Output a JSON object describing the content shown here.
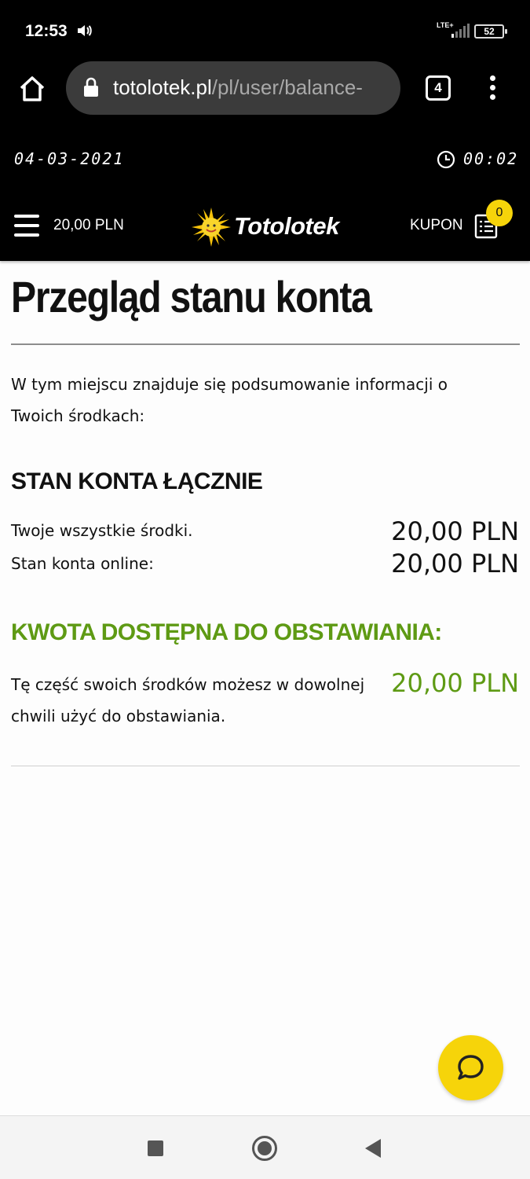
{
  "status_bar": {
    "time": "12:53",
    "network": "LTE+",
    "battery": "52",
    "icons": [
      "volume-icon",
      "signal-icon",
      "battery-icon"
    ]
  },
  "browser": {
    "url_domain": "totolotek.pl",
    "url_path": "/pl/user/balance-",
    "tab_count": "4",
    "icons": [
      "home-icon",
      "lock-icon",
      "more-vert-icon"
    ]
  },
  "site_header": {
    "date": "04-03-2021",
    "timer": "00:02",
    "balance": "20,00 PLN",
    "logo_text": "Totolotek",
    "kupon_label": "KUPON",
    "kupon_count": "0",
    "icons": [
      "menu-icon",
      "clock-icon",
      "coupon-list-icon"
    ],
    "colors": {
      "background": "#000000",
      "accent": "#f6d40a"
    }
  },
  "main": {
    "title": "Przegląd stanu konta",
    "intro": "W tym miejscu znajduje się podsumowanie informacji o Twoich środkach:",
    "total_section": {
      "title": "STAN KONTA ŁĄCZNIE",
      "rows": [
        {
          "label": "Twoje wszystkie środki.",
          "value": "20,00 PLN"
        },
        {
          "label": "Stan konta online:",
          "value": "20,00 PLN"
        }
      ]
    },
    "available_section": {
      "title": "KWOTA DOSTĘPNA DO OBSTAWIANIA:",
      "description": "Tę część swoich środków możesz w dowolnej chwili użyć do obstawiania.",
      "value": "20,00 PLN",
      "color": "#5e9a14"
    }
  },
  "chat": {
    "icon": "chat-bubble-icon",
    "color": "#f6d40a"
  },
  "navbar": {
    "icons": [
      "recents-icon",
      "home-circle-icon",
      "back-icon"
    ]
  }
}
